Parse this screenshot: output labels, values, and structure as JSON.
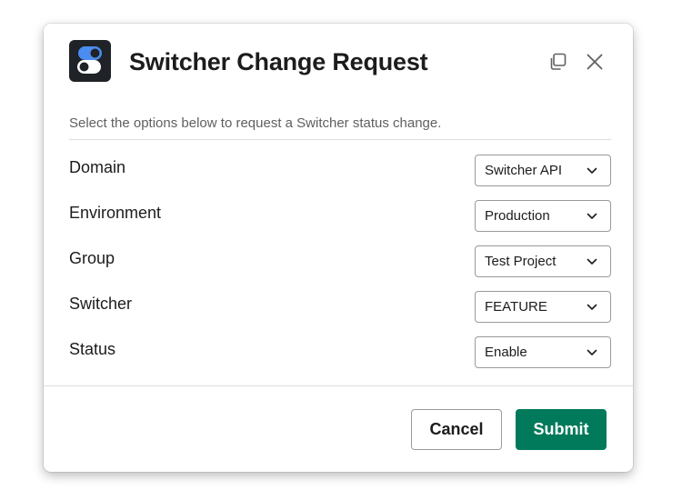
{
  "modal": {
    "title": "Switcher Change Request",
    "app_icon": "toggle-switches-icon",
    "header_actions": [
      {
        "icon": "copy-icon"
      },
      {
        "icon": "close-icon"
      }
    ]
  },
  "form": {
    "description": "Select the options below to request a Switcher status change.",
    "fields": [
      {
        "label": "Domain",
        "value": "Switcher API"
      },
      {
        "label": "Environment",
        "value": "Production"
      },
      {
        "label": "Group",
        "value": "Test Project"
      },
      {
        "label": "Switcher",
        "value": "FEATURE"
      },
      {
        "label": "Status",
        "value": "Enable"
      }
    ]
  },
  "footer": {
    "cancel_label": "Cancel",
    "submit_label": "Submit"
  },
  "colors": {
    "submit_bg": "#007a5a",
    "toggle_on": "#4a8cf0",
    "app_icon_bg": "#1f2226"
  }
}
